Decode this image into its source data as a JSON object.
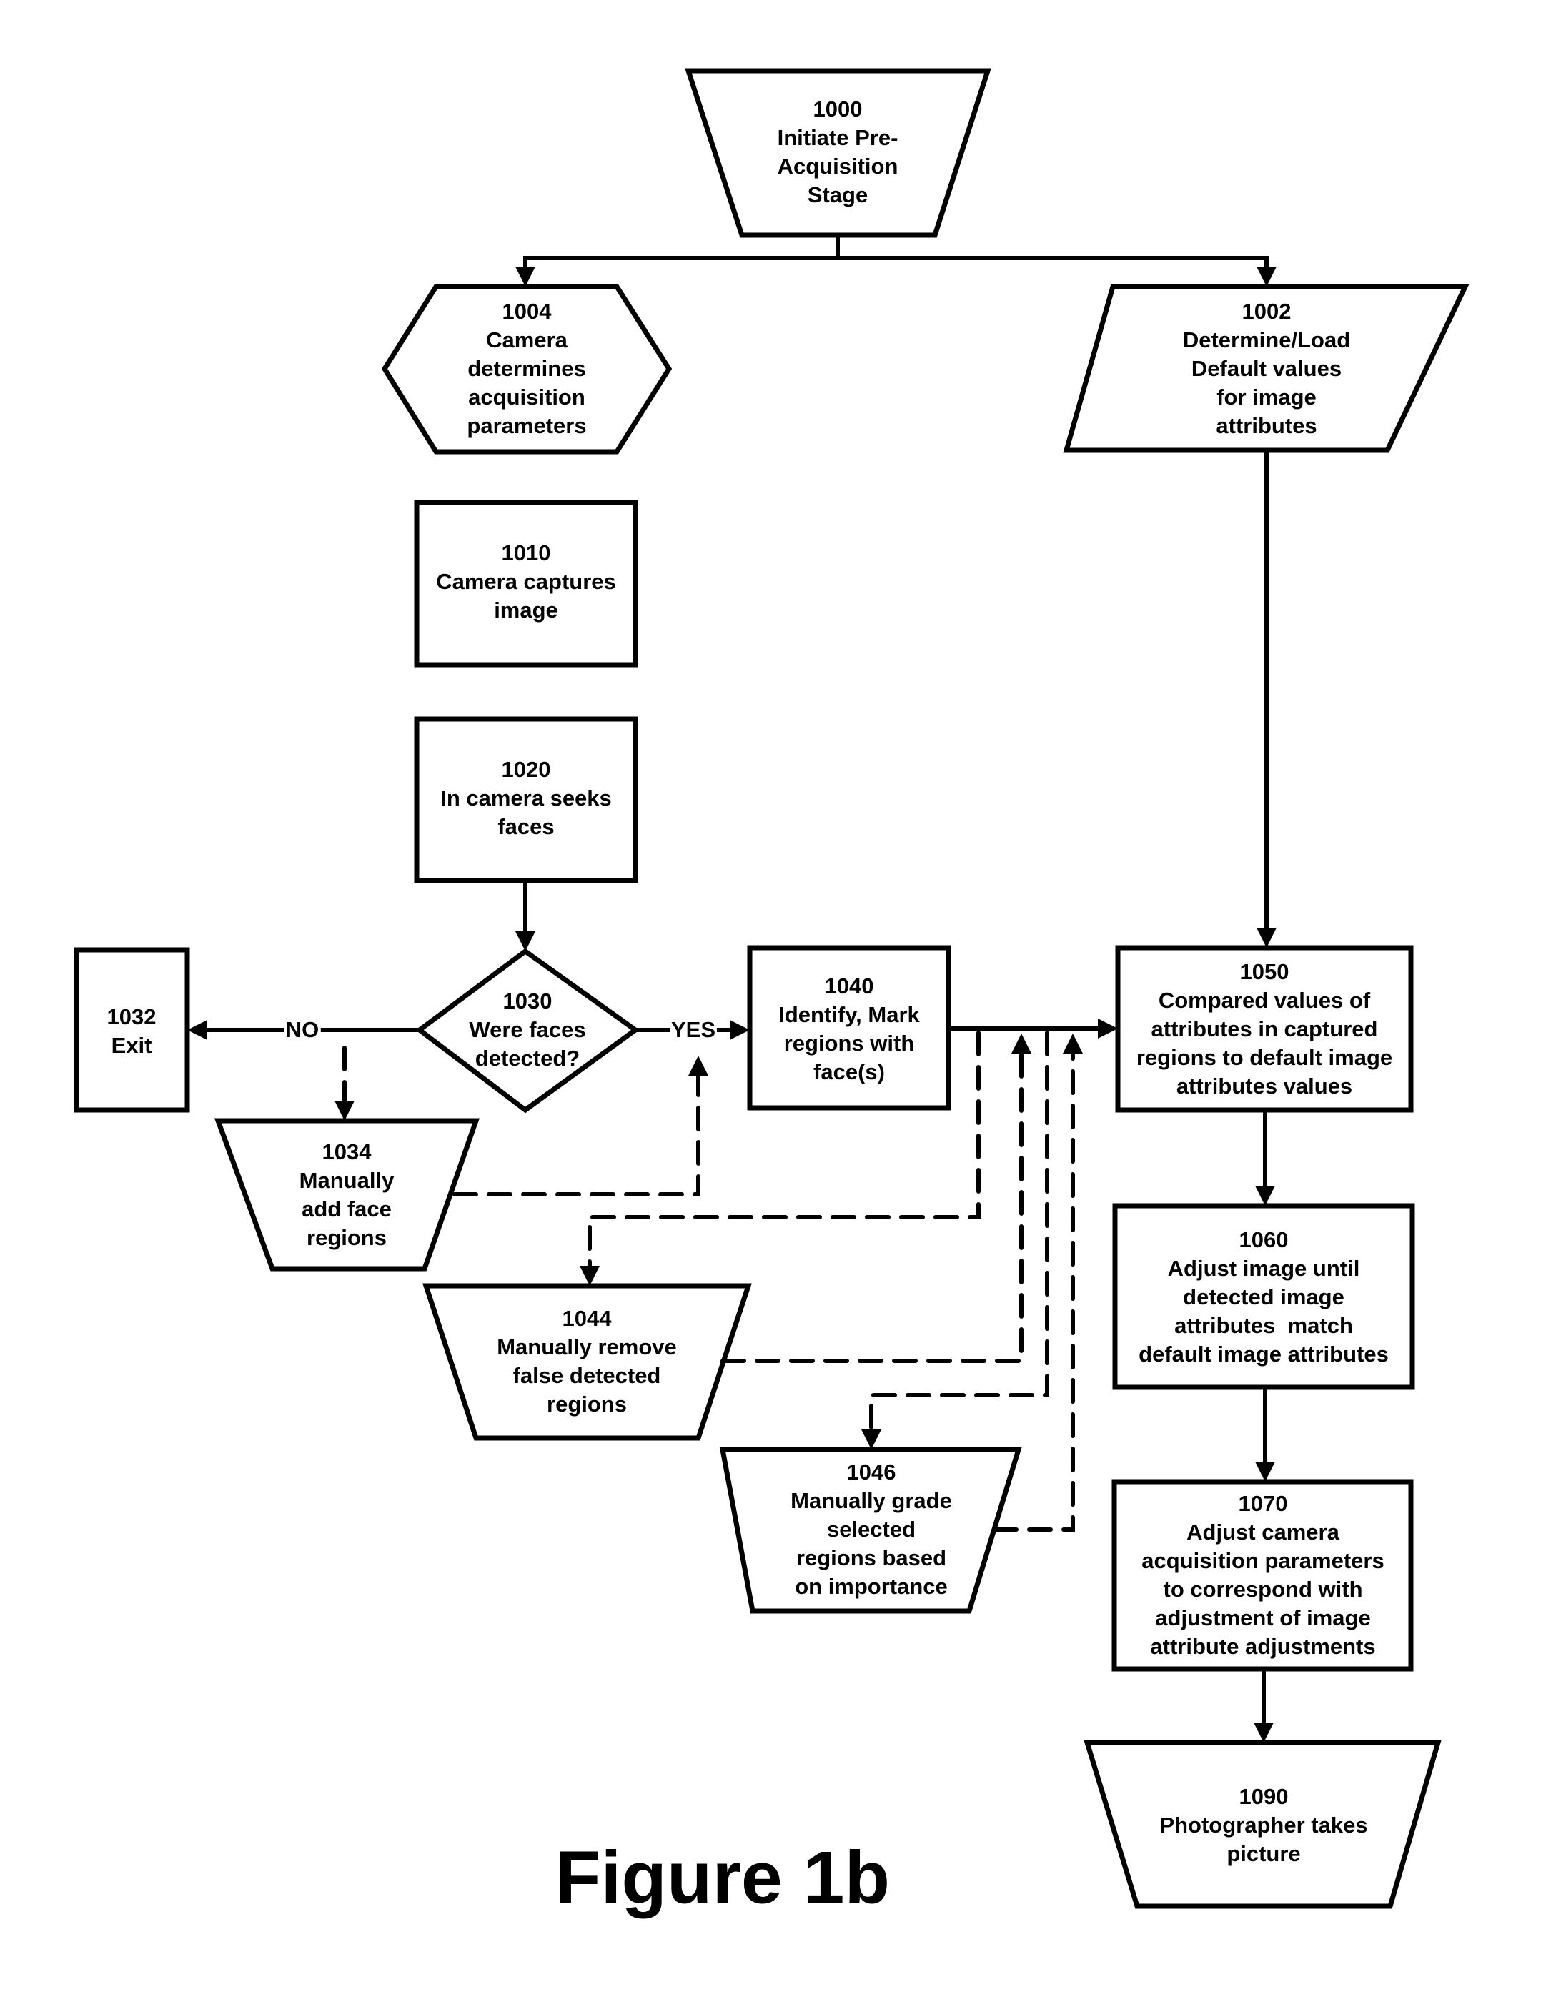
{
  "figure": {
    "caption": "Figure 1b"
  },
  "nodes": {
    "n1000": {
      "id": "1000",
      "shape": "trapezoid",
      "lines": [
        "Initiate Pre-",
        "Acquisition",
        "Stage"
      ]
    },
    "n1004": {
      "id": "1004",
      "shape": "hexagon",
      "lines": [
        "Camera",
        "determines",
        "acquisition",
        "parameters"
      ]
    },
    "n1002": {
      "id": "1002",
      "shape": "parallelogram",
      "lines": [
        "Determine/Load",
        "Default values",
        "for image",
        "attributes"
      ]
    },
    "n1010": {
      "id": "1010",
      "shape": "rectangle",
      "lines": [
        "Camera captures",
        "image"
      ]
    },
    "n1020": {
      "id": "1020",
      "shape": "rectangle",
      "lines": [
        "In camera seeks",
        "faces"
      ]
    },
    "n1030": {
      "id": "1030",
      "shape": "diamond",
      "lines": [
        "Were faces",
        "detected?"
      ]
    },
    "n1032": {
      "id": "1032",
      "shape": "rectangle",
      "lines": [
        "Exit"
      ]
    },
    "n1034": {
      "id": "1034",
      "shape": "trapezoid",
      "lines": [
        "Manually",
        "add face",
        "regions"
      ]
    },
    "n1040": {
      "id": "1040",
      "shape": "rectangle",
      "lines": [
        "Identify, Mark",
        "regions with",
        "face(s)"
      ]
    },
    "n1044": {
      "id": "1044",
      "shape": "trapezoid",
      "lines": [
        "Manually remove",
        "false detected",
        "regions"
      ]
    },
    "n1046": {
      "id": "1046",
      "shape": "trapezoid",
      "lines": [
        "Manually grade",
        "selected",
        "regions based",
        "on importance"
      ]
    },
    "n1050": {
      "id": "1050",
      "shape": "rectangle",
      "lines": [
        "Compared values of",
        "attributes in captured",
        "regions to default image",
        "attributes values"
      ]
    },
    "n1060": {
      "id": "1060",
      "shape": "rectangle",
      "lines": [
        "Adjust image until",
        "detected image",
        "attributes  match",
        "default image attributes"
      ]
    },
    "n1070": {
      "id": "1070",
      "shape": "rectangle",
      "lines": [
        "Adjust camera",
        "acquisition parameters",
        "to correspond with",
        "adjustment of image",
        "attribute adjustments"
      ]
    },
    "n1090": {
      "id": "1090",
      "shape": "trapezoid",
      "lines": [
        "Photographer takes",
        "picture"
      ]
    }
  },
  "edges": {
    "no_label": "NO",
    "yes_label": "YES",
    "list": [
      {
        "from": "1000",
        "to": "1004",
        "style": "solid"
      },
      {
        "from": "1000",
        "to": "1002",
        "style": "solid"
      },
      {
        "from": "1002",
        "to": "1050",
        "style": "solid"
      },
      {
        "from": "1020",
        "to": "1030",
        "style": "solid"
      },
      {
        "from": "1030",
        "to": "1032",
        "style": "solid",
        "label": "NO"
      },
      {
        "from": "1030",
        "to": "1034",
        "style": "dashed"
      },
      {
        "from": "1034",
        "to": "1040",
        "style": "dashed"
      },
      {
        "from": "1030",
        "to": "1040",
        "style": "solid",
        "label": "YES"
      },
      {
        "from": "1040",
        "to": "1050",
        "style": "solid"
      },
      {
        "from": "1040",
        "to": "1044",
        "style": "dashed"
      },
      {
        "from": "1044",
        "to": "1050",
        "style": "dashed"
      },
      {
        "from": "1040",
        "to": "1046",
        "style": "dashed"
      },
      {
        "from": "1046",
        "to": "1050",
        "style": "dashed"
      },
      {
        "from": "1050",
        "to": "1060",
        "style": "solid"
      },
      {
        "from": "1060",
        "to": "1070",
        "style": "solid"
      },
      {
        "from": "1070",
        "to": "1090",
        "style": "solid"
      }
    ]
  }
}
